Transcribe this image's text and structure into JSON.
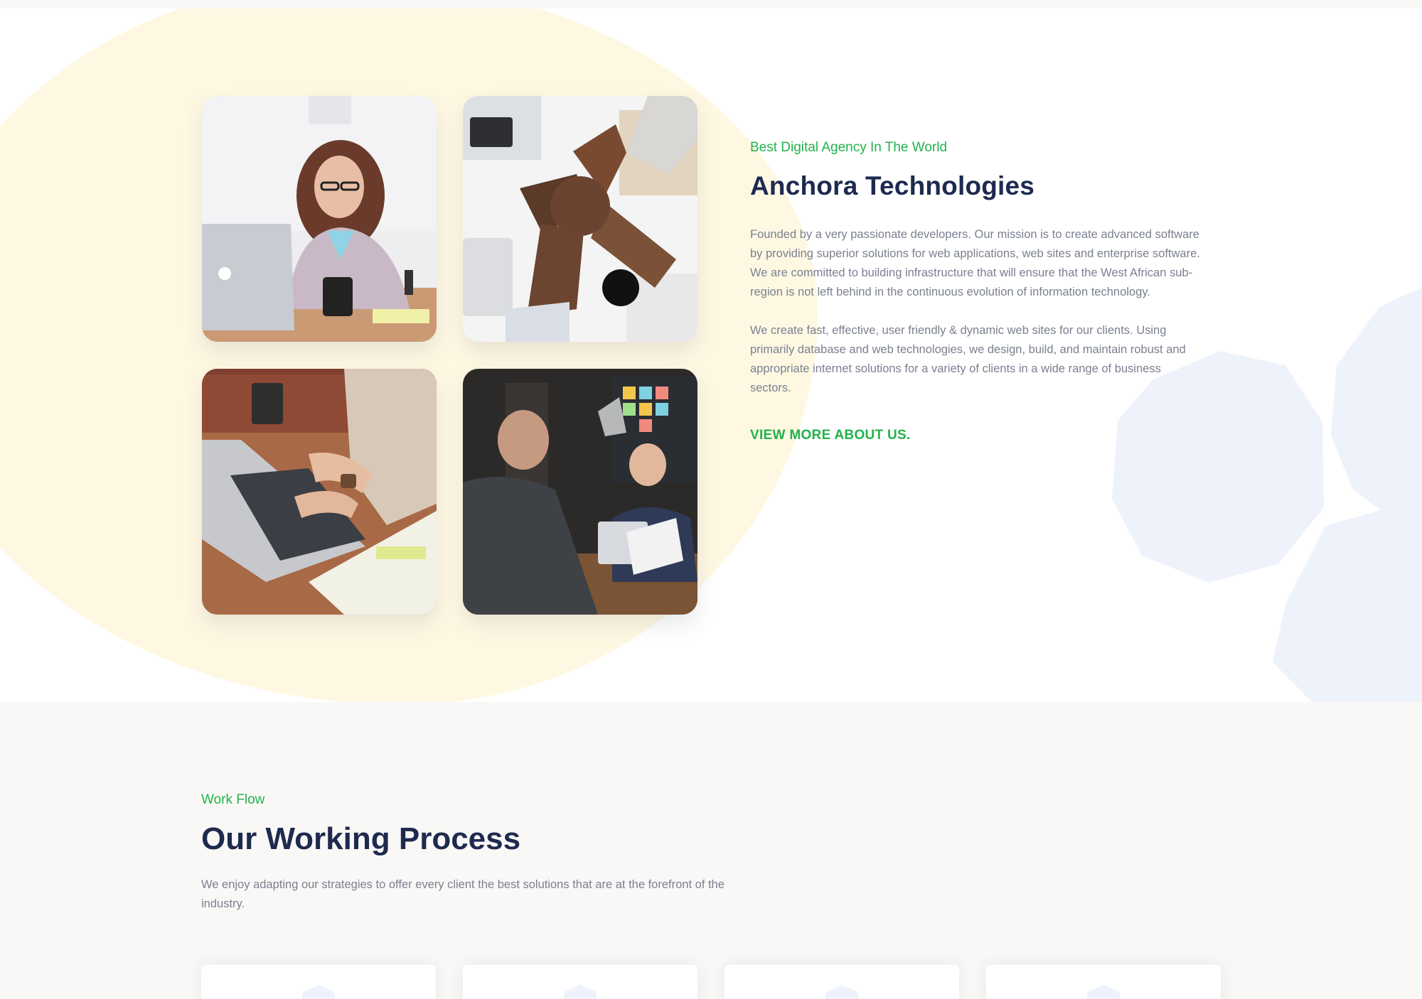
{
  "about": {
    "eyebrow": "Best Digital Agency In The World",
    "title": "Anchora Technologies",
    "paragraphs": [
      "Founded by a very passionate developers. Our mission is to create advanced software by providing superior solutions for web applications, web sites and enterprise software. We are committed to building infrastructure that will ensure that the West African sub-region is not left behind in the continuous evolution of information technology.",
      "We create fast, effective, user friendly & dynamic web sites for our clients. Using primarily database and web technologies, we design, build, and maintain robust and appropriate internet solutions for a variety of clients in a wide range of business sectors."
    ],
    "link_label": "VIEW MORE ABOUT US.",
    "photos": [
      {
        "icon": "woman-at-laptop-photo"
      },
      {
        "icon": "fist-bump-team-photo"
      },
      {
        "icon": "typing-on-laptop-photo"
      },
      {
        "icon": "business-meeting-photo"
      }
    ]
  },
  "workflow": {
    "eyebrow": "Work Flow",
    "title": "Our Working Process",
    "description": "We enjoy adapting our strategies to offer every client the best solutions that are at the forefront of the industry.",
    "cards": [
      {
        "icon": "hexagon-icon"
      },
      {
        "icon": "hexagon-icon"
      },
      {
        "icon": "hexagon-icon"
      },
      {
        "icon": "hexagon-icon"
      }
    ]
  },
  "colors": {
    "accent_green": "#22b24c",
    "heading_navy": "#1e2a4f",
    "body_gray": "#7b8090",
    "blob_cream": "#fef8e3",
    "section_bg": "#faf8f6",
    "hex_tint": "#eef2fb"
  }
}
